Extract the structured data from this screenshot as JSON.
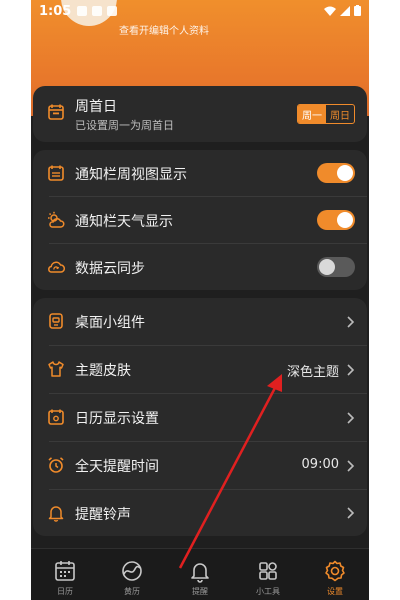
{
  "status": {
    "time": "1:05"
  },
  "profile": {
    "hint": "查看开编辑个人资料"
  },
  "week_start": {
    "title": "周首日",
    "subtitle": "已设置周一为周首日",
    "options": [
      "周一",
      "周日"
    ],
    "selected": "周一"
  },
  "toggles": [
    {
      "label": "通知栏周视图显示",
      "state": "on",
      "icon": "calendar-week-icon"
    },
    {
      "label": "通知栏天气显示",
      "state": "on",
      "icon": "weather-icon"
    },
    {
      "label": "数据云同步",
      "state": "off",
      "icon": "cloud-sync-icon"
    }
  ],
  "menu": [
    {
      "label": "桌面小组件",
      "value": "",
      "icon": "widget-icon"
    },
    {
      "label": "主题皮肤",
      "value": "深色主题",
      "icon": "tshirt-icon"
    },
    {
      "label": "日历显示设置",
      "value": "",
      "icon": "calendar-settings-icon"
    },
    {
      "label": "全天提醒时间",
      "value": "09:00",
      "icon": "alarm-clock-icon"
    },
    {
      "label": "提醒铃声",
      "value": "",
      "icon": "bell-icon"
    }
  ],
  "tabs": [
    {
      "label": "日历",
      "icon": "calendar-icon",
      "active": false
    },
    {
      "label": "黄历",
      "icon": "almanac-icon",
      "active": false
    },
    {
      "label": "提醒",
      "icon": "bell-icon",
      "active": false
    },
    {
      "label": "小工具",
      "icon": "grid-icon",
      "active": false
    },
    {
      "label": "设置",
      "icon": "settings-icon",
      "active": true
    }
  ],
  "colors": {
    "accent": "#f08b2b",
    "background": "#1f1f1f",
    "card": "#2a2a2a",
    "annotation_arrow": "#e02020"
  }
}
